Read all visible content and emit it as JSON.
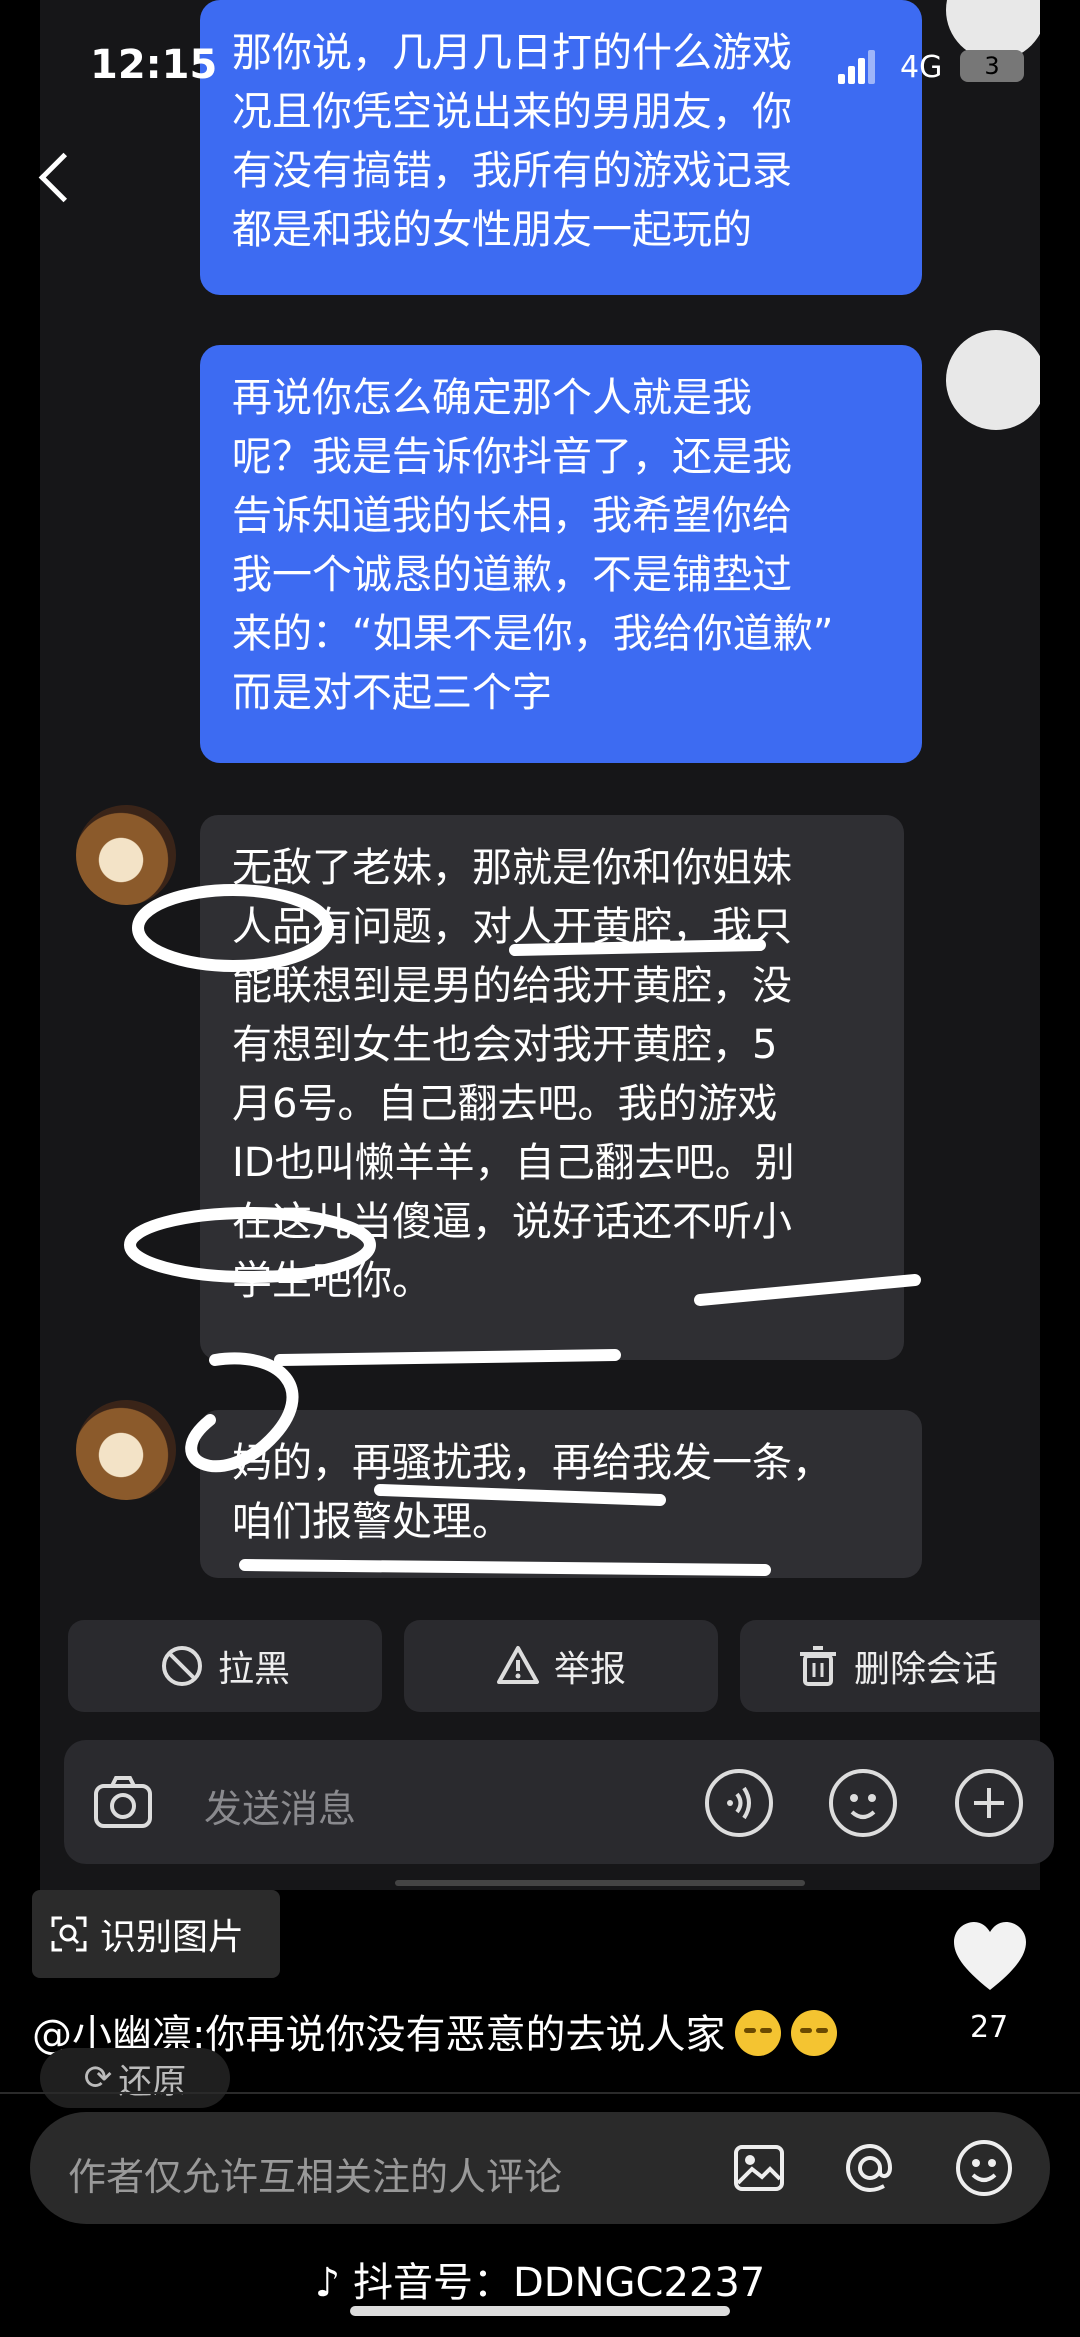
{
  "status": {
    "time": "12:15",
    "network": "4G",
    "battery": "3"
  },
  "messages": [
    {
      "side": "sent",
      "text": "那你说，几月几日打的什么游戏\n况且你凭空说出来的男朋友，你\n有没有搞错，我所有的游戏记录\n都是和我的女性朋友一起玩的"
    },
    {
      "side": "sent",
      "text": "再说你怎么确定那个人就是我\n呢？我是告诉你抖音了，还是我\n告诉知道我的长相，我希望你给\n我一个诚恳的道歉，不是铺垫过\n来的：“如果不是你，我给你道歉”\n而是对不起三个字"
    },
    {
      "side": "received",
      "text": "无敌了老妹，那就是你和你姐妹\n人品有问题，对人开黄腔，我只\n能联想到是男的给我开黄腔，没\n有想到女生也会对我开黄腔，5\n月6号。自己翻去吧。我的游戏\nID也叫懒羊羊，自己翻去吧。别\n在这儿当傻逼，说好话还不听小\n学生吧你。"
    },
    {
      "side": "received",
      "text": "妈的，再骚扰我，再给我发一条，\n咱们报警处理。"
    }
  ],
  "actions": {
    "block": "拉黑",
    "report": "举报",
    "delete": "删除会话"
  },
  "chat_input": {
    "placeholder": "发送消息"
  },
  "ocr_button": "识别图片",
  "caption": {
    "user": "@小幽凛",
    "text": "你再说你没有恶意的去说人家"
  },
  "likes": "27",
  "restore": "还原",
  "comment_input": {
    "placeholder": "作者仅允许互相关注的人评论"
  },
  "watermark": {
    "label": "抖音号：",
    "id": "DDNGC2237"
  },
  "icons": [
    "back-icon",
    "camera-icon",
    "voice-icon",
    "emoji-icon",
    "plus-icon",
    "block-icon",
    "warning-icon",
    "trash-icon",
    "scan-icon",
    "heart-icon",
    "image-icon",
    "at-icon",
    "tiktok-logo-icon"
  ],
  "colors": {
    "sent_bubble": "#3d6bf2",
    "received_bubble": "#2f2f33",
    "background": "#161618"
  }
}
